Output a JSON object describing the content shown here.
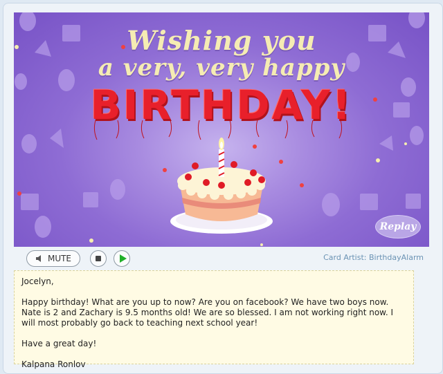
{
  "card": {
    "line1": "Wishing you",
    "line2": "a very, very happy",
    "birthday": "BIRTHDAY!",
    "replay_label": "Replay",
    "background_color": "#8e6cd4",
    "title_color": "#f5ecb3",
    "birthday_color": "#e8202b"
  },
  "controls": {
    "mute_label": "MUTE",
    "stop_icon": "stop-icon",
    "play_icon": "play-icon",
    "artist_text": "Card Artist: BirthdayAlarm"
  },
  "message": {
    "greeting": "Jocelyn,",
    "body": "Happy birthday! What are you up to now? Are you on facebook? We have two boys now. Nate is 2 and Zachary is 9.5 months old! We are so blessed. I am not working right now. I will most probably go back to teaching next school year!",
    "closing": "Have a great day!",
    "signature": "Kalpana Ronlov"
  }
}
